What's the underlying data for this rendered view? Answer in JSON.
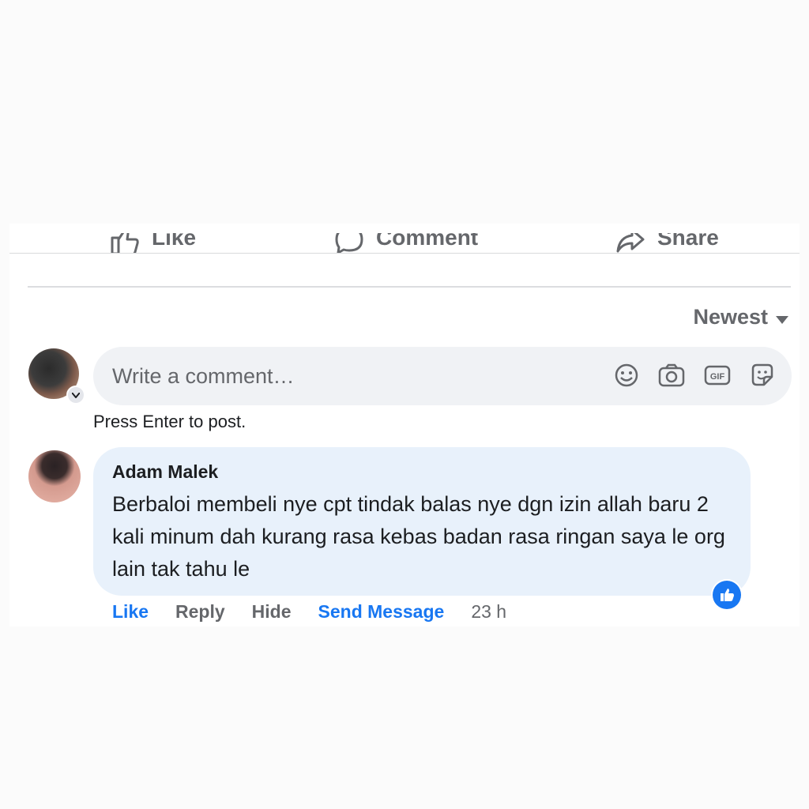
{
  "actions": {
    "like": "Like",
    "comment": "Comment",
    "share": "Share"
  },
  "sort": {
    "label": "Newest",
    "icon": "caret-down-icon"
  },
  "composer": {
    "placeholder": "Write a comment…",
    "hint": "Press Enter to post.",
    "icons": [
      "emoji-icon",
      "camera-icon",
      "gif-icon",
      "sticker-icon"
    ]
  },
  "comment": {
    "author": "Adam Malek",
    "body": "Berbaloi membeli nye cpt tindak balas nye dgn izin allah baru 2 kali minum dah kurang rasa kebas badan rasa ringan saya le org lain tak tahu le",
    "actions": {
      "like": "Like",
      "reply": "Reply",
      "hide": "Hide",
      "send_message": "Send Message",
      "time": "23 h"
    },
    "reaction": "like-reaction-icon"
  },
  "colors": {
    "accent": "#1877f2",
    "bubble": "#e8f1fb",
    "input_bg": "#f0f2f5",
    "secondary_text": "#65676b"
  }
}
